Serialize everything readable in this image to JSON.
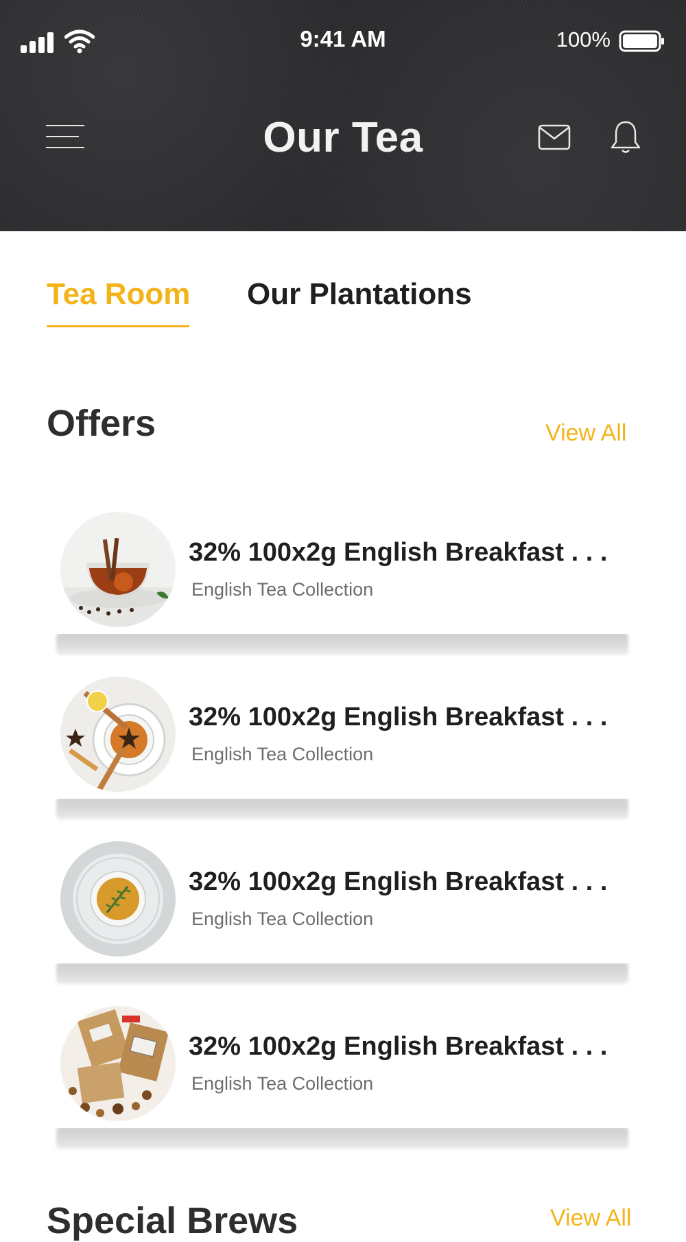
{
  "status_bar": {
    "time": "9:41 AM",
    "battery_percent": "100%",
    "signal_icon": "cellular-signal-icon",
    "wifi_icon": "wifi-icon",
    "battery_icon": "battery-icon"
  },
  "header": {
    "title": "Our Tea",
    "menu_icon": "hamburger-menu-icon",
    "mail_icon": "envelope-icon",
    "bell_icon": "bell-icon"
  },
  "tabs": [
    {
      "label": "Tea Room",
      "active": true
    },
    {
      "label": "Our Plantations",
      "active": false
    }
  ],
  "offers": {
    "title": "Offers",
    "view_all": "View All",
    "items": [
      {
        "title": "32% 100x2g English Breakfast . . .",
        "subtitle": "English Tea Collection",
        "image": "tea-cup-with-cinnamon-and-orange"
      },
      {
        "title": "32% 100x2g English Breakfast . . .",
        "subtitle": "English Tea Collection",
        "image": "tea-cup-with-star-anise-and-lemon"
      },
      {
        "title": "32% 100x2g English Breakfast . . .",
        "subtitle": "English Tea Collection",
        "image": "tea-cup-with-rosemary"
      },
      {
        "title": "32% 100x2g English Breakfast . . .",
        "subtitle": "English Tea Collection",
        "image": "tea-packages-with-dried-herbs"
      }
    ]
  },
  "special_brews": {
    "title": "Special Brews",
    "view_all": "View All"
  },
  "colors": {
    "accent": "#f3b41a",
    "header_bg": "#2b2b2e",
    "text_dark": "#1f1f22",
    "text_muted": "#6d6d70"
  }
}
